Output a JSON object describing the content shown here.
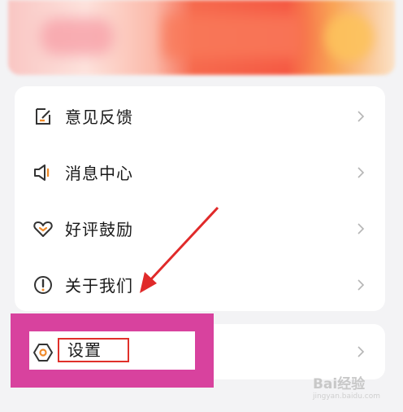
{
  "menu": {
    "items": [
      {
        "label": "意见反馈",
        "icon": "feedback-icon"
      },
      {
        "label": "消息中心",
        "icon": "speaker-icon"
      },
      {
        "label": "好评鼓励",
        "icon": "heart-icon"
      },
      {
        "label": "关于我们",
        "icon": "info-icon"
      }
    ]
  },
  "settings": {
    "label": "设置",
    "icon": "hexagon-gear-icon"
  },
  "annotation": {
    "highlight_color": "#d8429e",
    "box_color": "#e0302a",
    "arrow_color": "#e02a2a"
  },
  "watermark": {
    "text": "Bai经验",
    "sub": "jingyan.baidu.com"
  }
}
